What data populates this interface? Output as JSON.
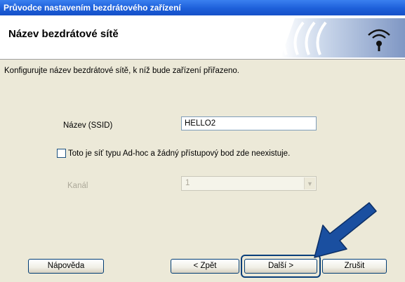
{
  "window": {
    "title": "Průvodce nastavením bezdrátového zařízení"
  },
  "header": {
    "title": "Název bezdrátové sítě"
  },
  "form": {
    "intro": "Konfigurujte název bezdrátové sítě, k níž bude zařízení přiřazeno.",
    "ssid_label": "Název (SSID)",
    "ssid_value": "HELLO2",
    "adhoc_label": "Toto je síť typu Ad-hoc a žádný přístupový bod zde neexistuje.",
    "adhoc_checked": false,
    "channel_label": "Kanál",
    "channel_value": "1",
    "channel_enabled": false
  },
  "buttons": {
    "help": "Nápověda",
    "back": "< Zpět",
    "next": "Další >",
    "cancel": "Zrušit"
  },
  "colors": {
    "titlebar": "#1d5fd9",
    "panel": "#ece9d8",
    "arrow": "#1a4fa0",
    "highlight": "#0a3f7a"
  },
  "icons": {
    "logo": "wireless-logo-icon",
    "pointer": "pointer-arrow-icon"
  }
}
